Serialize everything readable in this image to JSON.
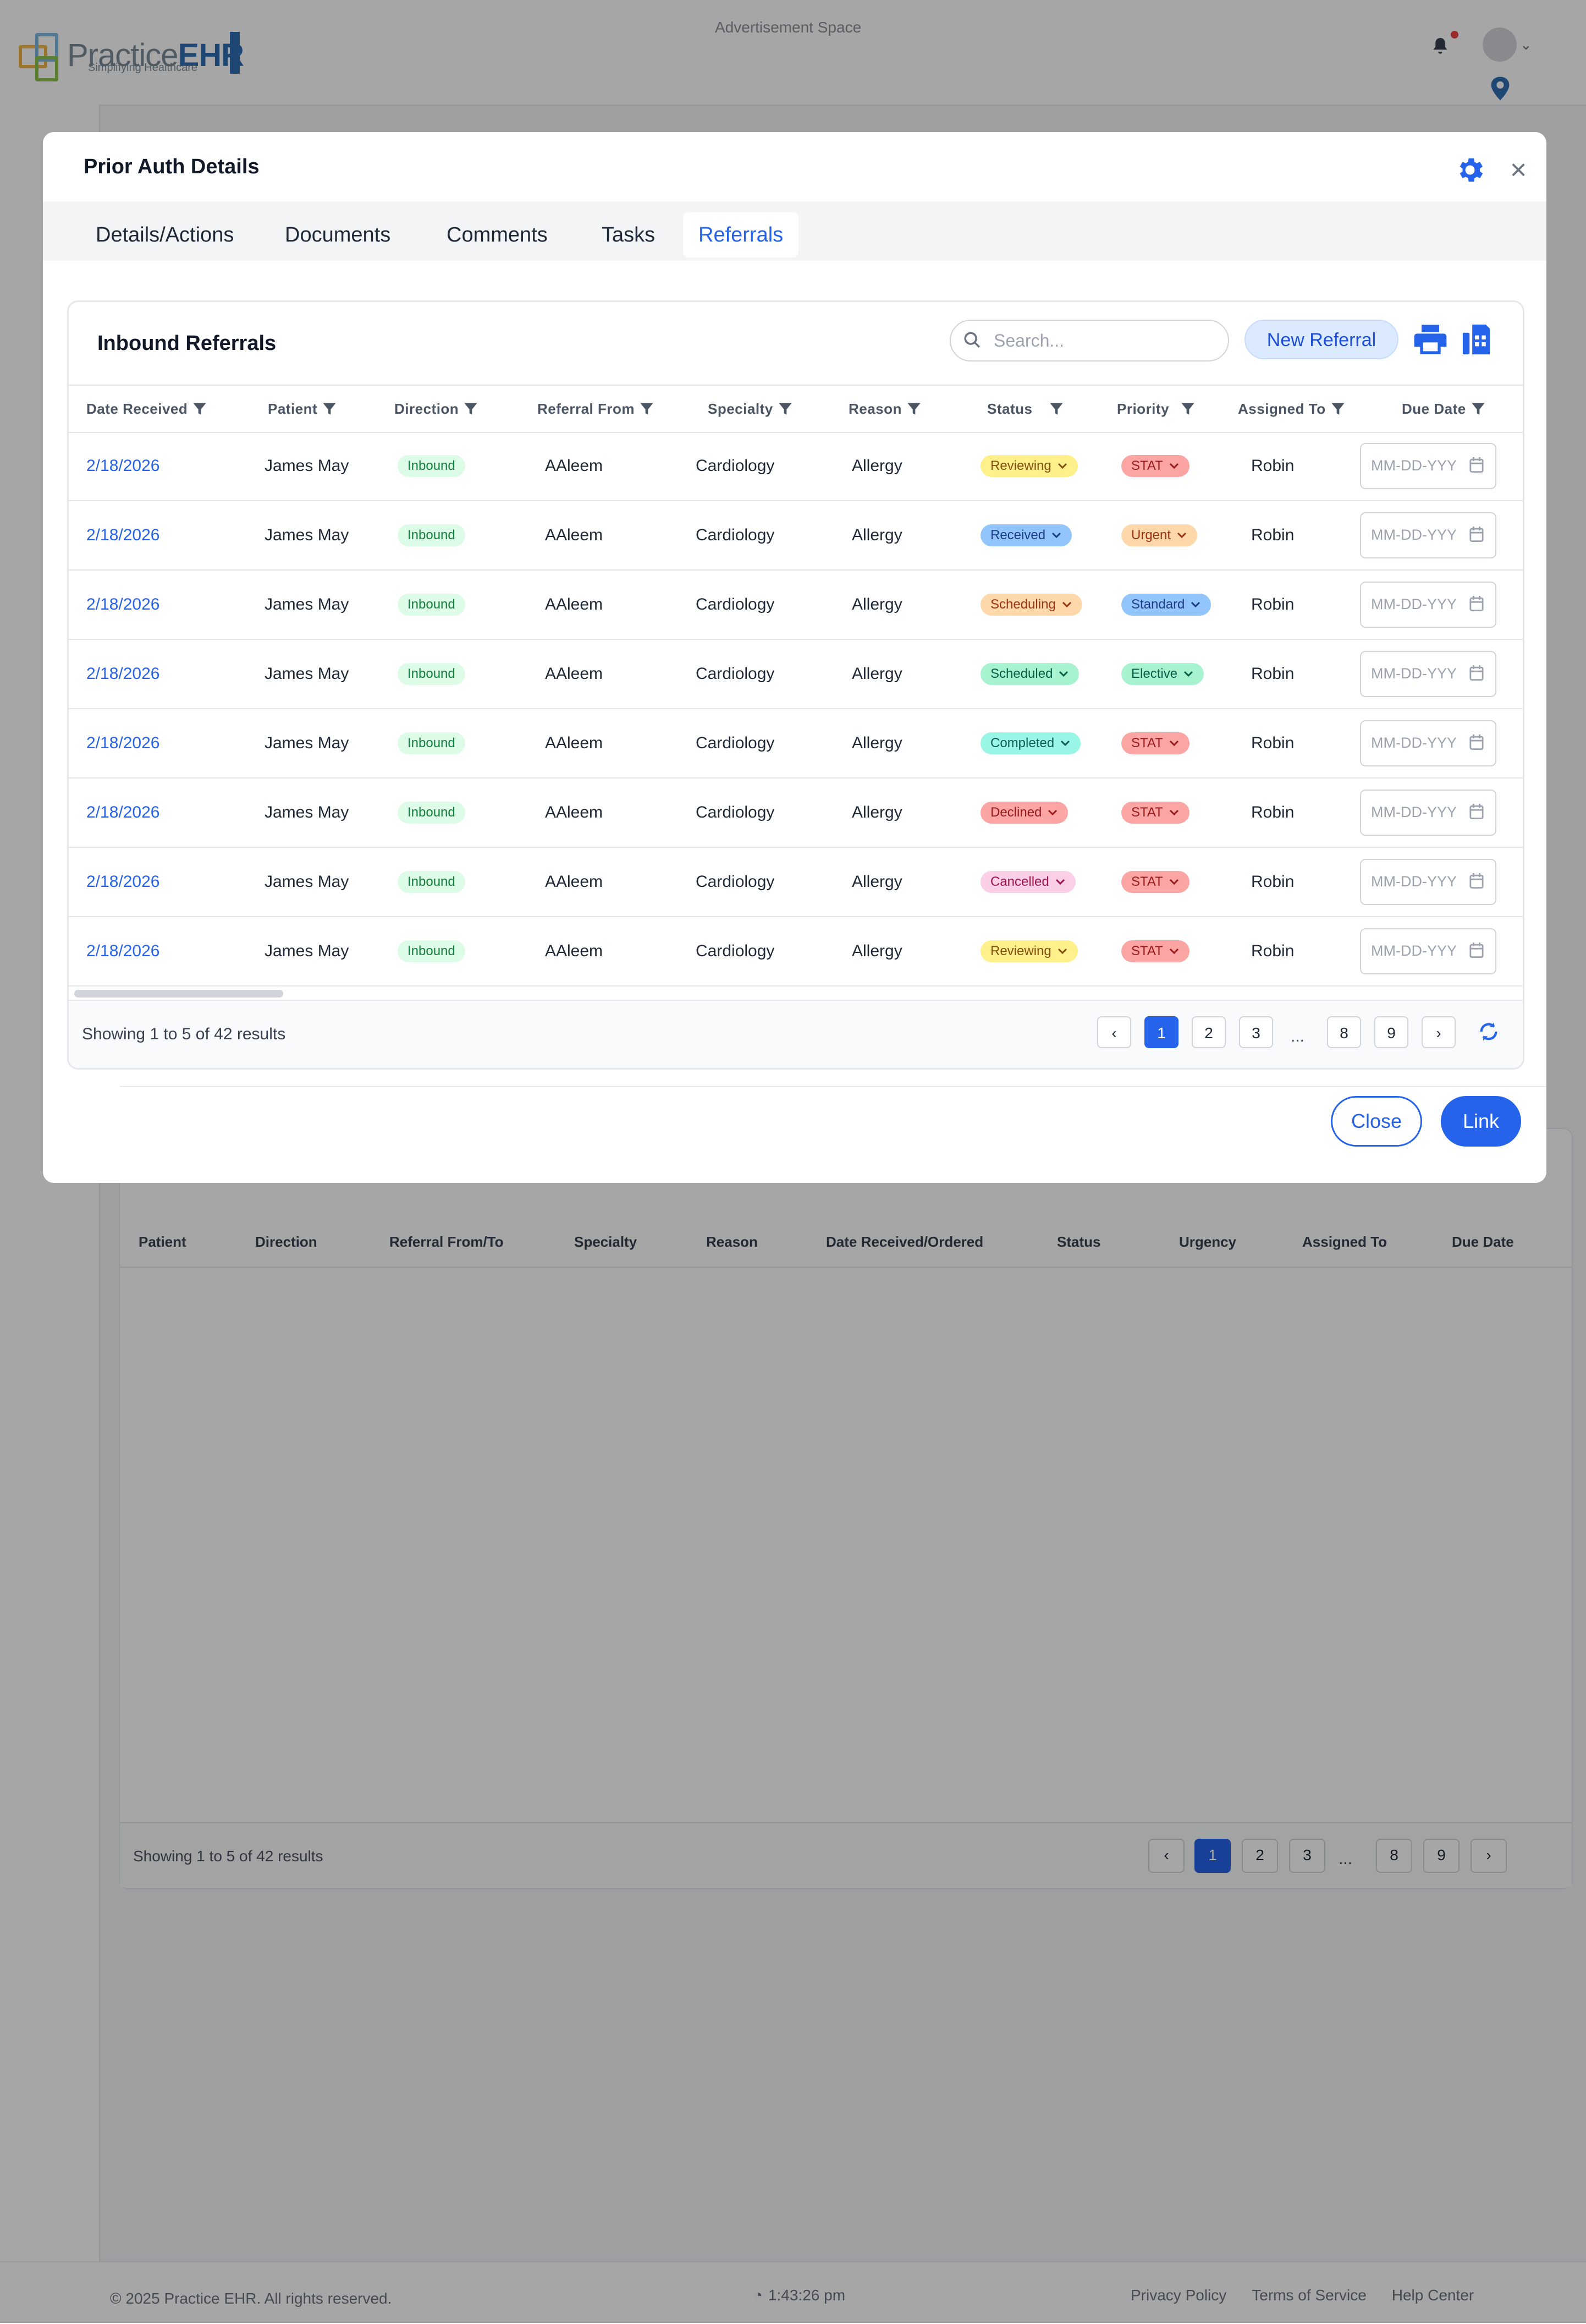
{
  "background": {
    "logo_prefix": "Practice",
    "logo_suffix": "EHR",
    "logo_tagline": "Simplifying Healthcare",
    "ad_text": "Advertisement Space",
    "table_headers": [
      "Patient",
      "Direction",
      "Referral From/To",
      "Specialty",
      "Reason",
      "Date Received/Ordered",
      "Status",
      "Urgency",
      "Assigned To",
      "Due Date"
    ],
    "results_text": "Showing 1 to 5 of 42 results",
    "pages": [
      "1",
      "2",
      "3",
      "...",
      "8",
      "9"
    ],
    "footer_copyright": "© 2025 Practice EHR. All rights reserved.",
    "footer_time": "1:43:26 pm",
    "footer_links": [
      "Privacy Policy",
      "Terms of Service",
      "Help Center"
    ]
  },
  "modal": {
    "title": "Prior Auth Details",
    "tabs": [
      {
        "label": "Details/Actions",
        "active": false
      },
      {
        "label": "Documents",
        "active": false
      },
      {
        "label": "Comments",
        "active": false
      },
      {
        "label": "Tasks",
        "active": false
      },
      {
        "label": "Referrals",
        "active": true
      }
    ],
    "close_label": "Close",
    "link_label": "Link"
  },
  "referrals": {
    "title": "Inbound Referrals",
    "search_placeholder": "Search...",
    "new_referral_label": "New Referral",
    "headers": [
      "Date Received",
      "Patient",
      "Direction",
      "Referral From",
      "Specialty",
      "Reason",
      "Status",
      "Priority",
      "Assigned To",
      "Due Date"
    ],
    "due_placeholder": "MM-DD-YYY",
    "rows": [
      {
        "date": "2/18/2026",
        "patient": "James May",
        "direction": "Inbound",
        "from": "AAleem",
        "specialty": "Cardiology",
        "reason": "Allergy",
        "status": "Reviewing",
        "priority": "STAT",
        "assigned": "Robin"
      },
      {
        "date": "2/18/2026",
        "patient": "James May",
        "direction": "Inbound",
        "from": "AAleem",
        "specialty": "Cardiology",
        "reason": "Allergy",
        "status": "Received",
        "priority": "Urgent",
        "assigned": "Robin"
      },
      {
        "date": "2/18/2026",
        "patient": "James May",
        "direction": "Inbound",
        "from": "AAleem",
        "specialty": "Cardiology",
        "reason": "Allergy",
        "status": "Scheduling",
        "priority": "Standard",
        "assigned": "Robin"
      },
      {
        "date": "2/18/2026",
        "patient": "James May",
        "direction": "Inbound",
        "from": "AAleem",
        "specialty": "Cardiology",
        "reason": "Allergy",
        "status": "Scheduled",
        "priority": "Elective",
        "assigned": "Robin"
      },
      {
        "date": "2/18/2026",
        "patient": "James May",
        "direction": "Inbound",
        "from": "AAleem",
        "specialty": "Cardiology",
        "reason": "Allergy",
        "status": "Completed",
        "priority": "STAT",
        "assigned": "Robin"
      },
      {
        "date": "2/18/2026",
        "patient": "James May",
        "direction": "Inbound",
        "from": "AAleem",
        "specialty": "Cardiology",
        "reason": "Allergy",
        "status": "Declined",
        "priority": "STAT",
        "assigned": "Robin"
      },
      {
        "date": "2/18/2026",
        "patient": "James May",
        "direction": "Inbound",
        "from": "AAleem",
        "specialty": "Cardiology",
        "reason": "Allergy",
        "status": "Cancelled",
        "priority": "STAT",
        "assigned": "Robin"
      },
      {
        "date": "2/18/2026",
        "patient": "James May",
        "direction": "Inbound",
        "from": "AAleem",
        "specialty": "Cardiology",
        "reason": "Allergy",
        "status": "Reviewing",
        "priority": "STAT",
        "assigned": "Robin"
      }
    ],
    "results_text": "Showing 1 to 5 of 42 results",
    "pages": [
      "1",
      "2",
      "3",
      "...",
      "8",
      "9"
    ],
    "current_page": "1"
  },
  "colors": {
    "accent": "#2563eb",
    "status": {
      "Reviewing": [
        "#fef08a",
        "#854d0e"
      ],
      "Received": [
        "#93c5fd",
        "#1e3a8a"
      ],
      "Scheduling": [
        "#fed7aa",
        "#9a3412"
      ],
      "Scheduled": [
        "#a7f3d0",
        "#065f46"
      ],
      "Completed": [
        "#99f6e4",
        "#115e59"
      ],
      "Declined": [
        "#fca5a5",
        "#991b1b"
      ],
      "Cancelled": [
        "#fbcfe8",
        "#9d174d"
      ]
    },
    "priority": {
      "STAT": [
        "#fca5a5",
        "#991b1b"
      ],
      "Urgent": [
        "#fed7aa",
        "#9a3412"
      ],
      "Standard": [
        "#93c5fd",
        "#1e3a8a"
      ],
      "Elective": [
        "#a7f3d0",
        "#065f46"
      ]
    }
  }
}
